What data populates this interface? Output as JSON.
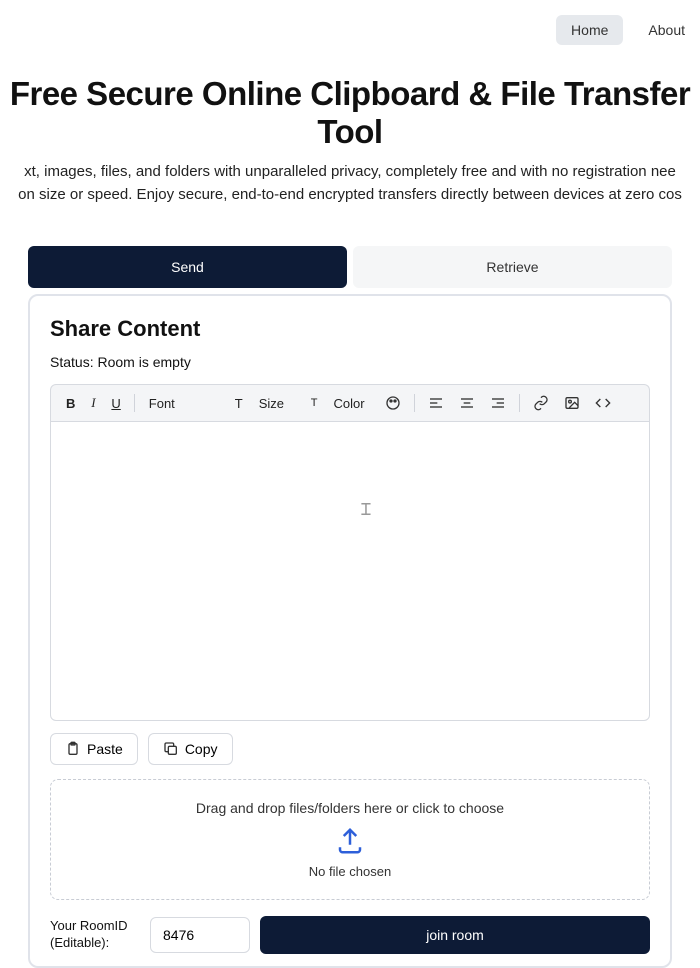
{
  "nav": {
    "home": "Home",
    "about": "About"
  },
  "hero": {
    "title": "Free Secure Online Clipboard & File Transfer Tool",
    "sub1": "xt, images, files, and folders with unparalleled privacy, completely free and with no registration nee",
    "sub2": "on size or speed. Enjoy secure, end-to-end encrypted transfers directly between devices at zero cos"
  },
  "tabs": {
    "send": "Send",
    "retrieve": "Retrieve"
  },
  "panel": {
    "title": "Share Content",
    "status": "Status: Room is empty"
  },
  "toolbar": {
    "font": "Font",
    "size": "Size",
    "color": "Color"
  },
  "actions": {
    "paste": "Paste",
    "copy": "Copy"
  },
  "dropzone": {
    "text": "Drag and drop files/folders here or click to choose",
    "nofile": "No file chosen"
  },
  "room": {
    "label": "Your RoomID (Editable):",
    "value": "8476",
    "join": "join room"
  }
}
